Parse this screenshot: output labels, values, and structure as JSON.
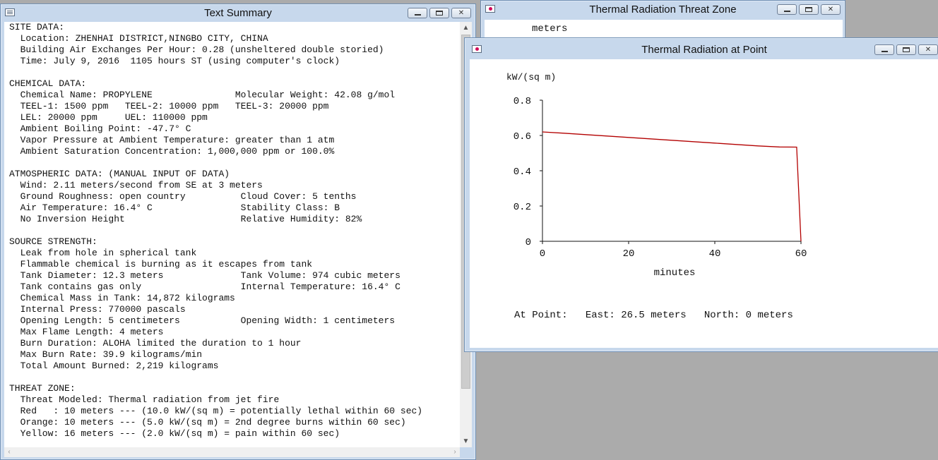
{
  "text_summary": {
    "title": "Text Summary",
    "lines": [
      "SITE DATA:",
      "  Location: ZHENHAI DISTRICT,NINGBO CITY, CHINA",
      "  Building Air Exchanges Per Hour: 0.28 (unsheltered double storied)",
      "  Time: July 9, 2016  1105 hours ST (using computer's clock)",
      "",
      "CHEMICAL DATA:",
      "  Chemical Name: PROPYLENE               Molecular Weight: 42.08 g/mol",
      "  TEEL-1: 1500 ppm   TEEL-2: 10000 ppm   TEEL-3: 20000 ppm",
      "  LEL: 20000 ppm     UEL: 110000 ppm",
      "  Ambient Boiling Point: -47.7° C",
      "  Vapor Pressure at Ambient Temperature: greater than 1 atm",
      "  Ambient Saturation Concentration: 1,000,000 ppm or 100.0%",
      "",
      "ATMOSPHERIC DATA: (MANUAL INPUT OF DATA)",
      "  Wind: 2.11 meters/second from SE at 3 meters",
      "  Ground Roughness: open country          Cloud Cover: 5 tenths",
      "  Air Temperature: 16.4° C                Stability Class: B",
      "  No Inversion Height                     Relative Humidity: 82%",
      "",
      "SOURCE STRENGTH:",
      "  Leak from hole in spherical tank",
      "  Flammable chemical is burning as it escapes from tank",
      "  Tank Diameter: 12.3 meters              Tank Volume: 974 cubic meters",
      "  Tank contains gas only                  Internal Temperature: 16.4° C",
      "  Chemical Mass in Tank: 14,872 kilograms",
      "  Internal Press: 770000 pascals",
      "  Opening Length: 5 centimeters           Opening Width: 1 centimeters",
      "  Max Flame Length: 4 meters",
      "  Burn Duration: ALOHA limited the duration to 1 hour",
      "  Max Burn Rate: 39.9 kilograms/min",
      "  Total Amount Burned: 2,219 kilograms",
      "",
      "THREAT ZONE:",
      "  Threat Modeled: Thermal radiation from jet fire",
      "  Red   : 10 meters --- (10.0 kW/(sq m) = potentially lethal within 60 sec)",
      "  Orange: 10 meters --- (5.0 kW/(sq m) = 2nd degree burns within 60 sec)",
      "  Yellow: 16 meters --- (2.0 kW/(sq m) = pain within 60 sec)"
    ]
  },
  "threat_zone_window": {
    "title": "Thermal Radiation Threat Zone",
    "unit_label": "meters"
  },
  "point_window": {
    "title": "Thermal Radiation at Point",
    "readout": "At Point:   East: 26.5 meters   North: 0 meters"
  },
  "colors": {
    "series_line": "#b30000",
    "axis": "#111111"
  },
  "chart_data": {
    "type": "line",
    "xlabel": "minutes",
    "ylabel": "kW/(sq m)",
    "xlim": [
      0,
      60
    ],
    "ylim": [
      0,
      0.8
    ],
    "x_ticks": [
      0,
      20,
      40,
      60
    ],
    "y_ticks": [
      0,
      0.2,
      0.4,
      0.6,
      0.8
    ],
    "y_tick_labels": [
      "0",
      "0.2",
      "0.4",
      "0.6",
      "0.8"
    ],
    "grid": false,
    "series": [
      {
        "x": [
          0,
          5,
          10,
          15,
          20,
          25,
          30,
          35,
          40,
          45,
          50,
          55,
          59,
          60
        ],
        "y": [
          0.62,
          0.613,
          0.605,
          0.597,
          0.589,
          0.581,
          0.573,
          0.565,
          0.557,
          0.549,
          0.541,
          0.535,
          0.534,
          0
        ]
      }
    ]
  }
}
